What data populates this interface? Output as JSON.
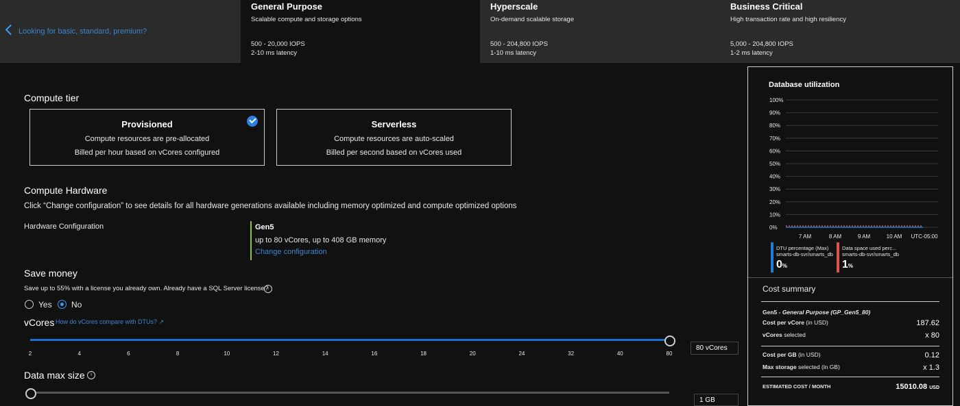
{
  "tiers": {
    "back_link": "Looking for basic, standard, premium?",
    "items": [
      {
        "title": "General Purpose",
        "desc": "Scalable compute and storage options",
        "iops": "500 - 20,000 IOPS",
        "latency": "2-10 ms latency"
      },
      {
        "title": "Hyperscale",
        "desc": "On-demand scalable storage",
        "iops": "500 - 204,800 IOPS",
        "latency": "1-10 ms latency"
      },
      {
        "title": "Business Critical",
        "desc": "High transaction rate and high resiliency",
        "iops": "5,000 - 204,800 IOPS",
        "latency": "1-2 ms latency"
      }
    ]
  },
  "compute_tier": {
    "heading": "Compute tier",
    "options": [
      {
        "title": "Provisioned",
        "line1": "Compute resources are pre-allocated",
        "line2": "Billed per hour based on vCores configured",
        "selected": true
      },
      {
        "title": "Serverless",
        "line1": "Compute resources are auto-scaled",
        "line2": "Billed per second based on vCores used",
        "selected": false
      }
    ]
  },
  "hardware": {
    "heading": "Compute Hardware",
    "description": "Click “Change configuration” to see details for all hardware generations available including memory optimized and compute optimized options",
    "label": "Hardware Configuration",
    "gen": "Gen5",
    "spec": "up to 80 vCores, up to 408 GB memory",
    "change_link": "Change configuration"
  },
  "save_money": {
    "heading": "Save money",
    "text": "Save up to 55% with a license you already own. Already have a SQL Server license?",
    "yes": "Yes",
    "no": "No",
    "selected": "No"
  },
  "vcores": {
    "heading": "vCores",
    "compare_link": "How do vCores compare with DTUs?",
    "ticks": [
      "2",
      "4",
      "6",
      "8",
      "10",
      "12",
      "14",
      "16",
      "18",
      "20",
      "24",
      "32",
      "40",
      "80"
    ],
    "value_text": "80 vCores",
    "fraction": 1.0
  },
  "data_max": {
    "heading": "Data max size",
    "value_text": "1 GB",
    "fraction": 0.0
  },
  "utilization": {
    "title": "Database utilization",
    "y_ticks": [
      "100%",
      "90%",
      "80%",
      "70%",
      "60%",
      "50%",
      "40%",
      "30%",
      "20%",
      "10%",
      "0%"
    ],
    "x_ticks": [
      "7 AM",
      "8 AM",
      "9 AM",
      "10 AM",
      "UTC-05:00"
    ],
    "legend": [
      {
        "name": "DTU percentage (Max)",
        "source": "smarts-db-svr/smarts_db",
        "value": "0",
        "unit": "%",
        "color": "#1e7fd8"
      },
      {
        "name": "Data space used perc...",
        "source": "smarts-db-svr/smarts_db",
        "value": "1",
        "unit": "%",
        "color": "#d9534f"
      }
    ]
  },
  "chart_data": {
    "type": "line",
    "title": "Database utilization",
    "x": [
      "7 AM",
      "8 AM",
      "9 AM",
      "10 AM"
    ],
    "ylim": [
      0,
      100
    ],
    "series": [
      {
        "name": "DTU percentage (Max)",
        "values": [
          0,
          0,
          0,
          0
        ]
      },
      {
        "name": "Data space used perc...",
        "values": [
          1,
          1,
          1,
          1
        ]
      }
    ]
  },
  "cost": {
    "title": "Cost summary",
    "tier_line_prefix": "Gen5 - ",
    "tier_line_italic": "General Purpose (GP_Gen5_80)",
    "rows": [
      {
        "label": "Cost per vCore",
        "suffix": " (in USD)",
        "value": "187.62"
      },
      {
        "label": "vCores",
        "suffix": " selected",
        "value": "x 80"
      },
      {
        "label": "Cost per GB",
        "suffix": " (in USD)",
        "value": "0.12"
      },
      {
        "label": "Max storage",
        "suffix": " selected (in GB)",
        "value": "x 1.3"
      }
    ],
    "estimate_label": "ESTIMATED COST / MONTH",
    "estimate_value": "15010.08",
    "estimate_unit": "USD"
  }
}
